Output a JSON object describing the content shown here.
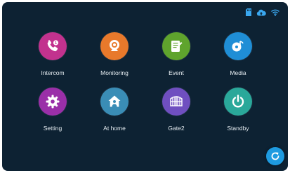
{
  "status_bar": {
    "icons": [
      "sd-card-icon",
      "cloud-icon",
      "wifi-icon"
    ],
    "icon_color": "#3aa8f0"
  },
  "menu": {
    "items": [
      {
        "label": "Intercom",
        "icon": "phone-icon",
        "color": "#c2328e"
      },
      {
        "label": "Monitoring",
        "icon": "camera-icon",
        "color": "#e8792b"
      },
      {
        "label": "Event",
        "icon": "notepad-icon",
        "color": "#5fa42d"
      },
      {
        "label": "Media",
        "icon": "media-disc-icon",
        "color": "#1f8ed6"
      },
      {
        "label": "Setting",
        "icon": "gear-icon",
        "color": "#9a2fa8"
      },
      {
        "label": "At home",
        "icon": "home-person-icon",
        "color": "#3a8db6"
      },
      {
        "label": "Gate2",
        "icon": "gate-icon",
        "color": "#6f4fc0"
      },
      {
        "label": "Standby",
        "icon": "power-icon",
        "color": "#2aa89a"
      }
    ]
  },
  "refresh_button": {
    "icon": "refresh-icon",
    "color": "#1e9be0"
  }
}
